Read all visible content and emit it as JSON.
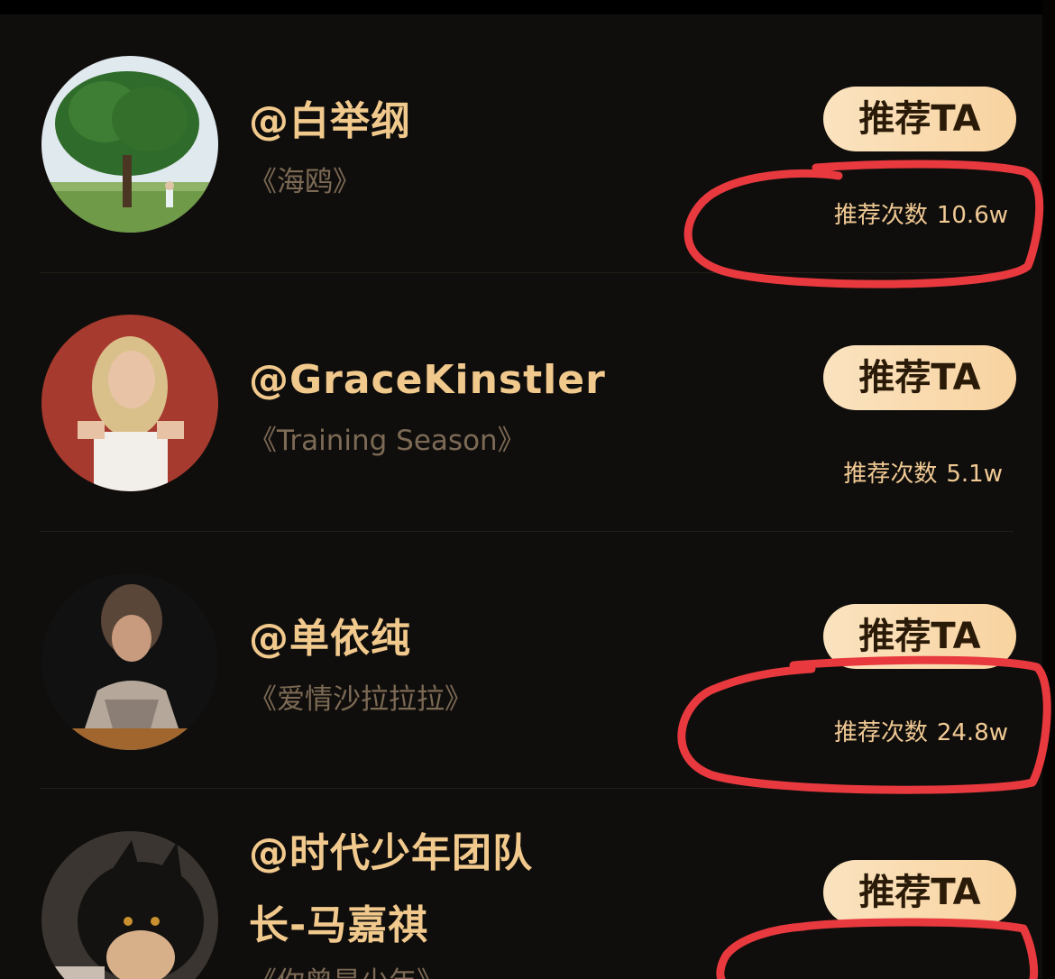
{
  "list": {
    "items": [
      {
        "name": "@白举纲",
        "work": "《海鸥》",
        "button_label": "推荐TA",
        "count_label": "推荐次数",
        "count_value": "10.6w"
      },
      {
        "name": "@GraceKinstler",
        "work": "《Training Season》",
        "button_label": "推荐TA",
        "count_label": "推荐次数",
        "count_value": "5.1w"
      },
      {
        "name": "@单依纯",
        "work": "《爱情沙拉拉拉》",
        "button_label": "推荐TA",
        "count_label": "推荐次数",
        "count_value": "24.8w"
      },
      {
        "name_line1": "@时代少年团队",
        "name_line2": "长-马嘉祺",
        "work": "《你曾是少年》",
        "button_label": "推荐TA"
      }
    ]
  },
  "colors": {
    "background": "#100e0c",
    "name_gold": "#f1c98d",
    "work_muted": "#7c6a55",
    "button_gradient_start": "#fbe3bf",
    "button_gradient_end": "#f8d3a0",
    "annotation_red": "#e8393f"
  }
}
